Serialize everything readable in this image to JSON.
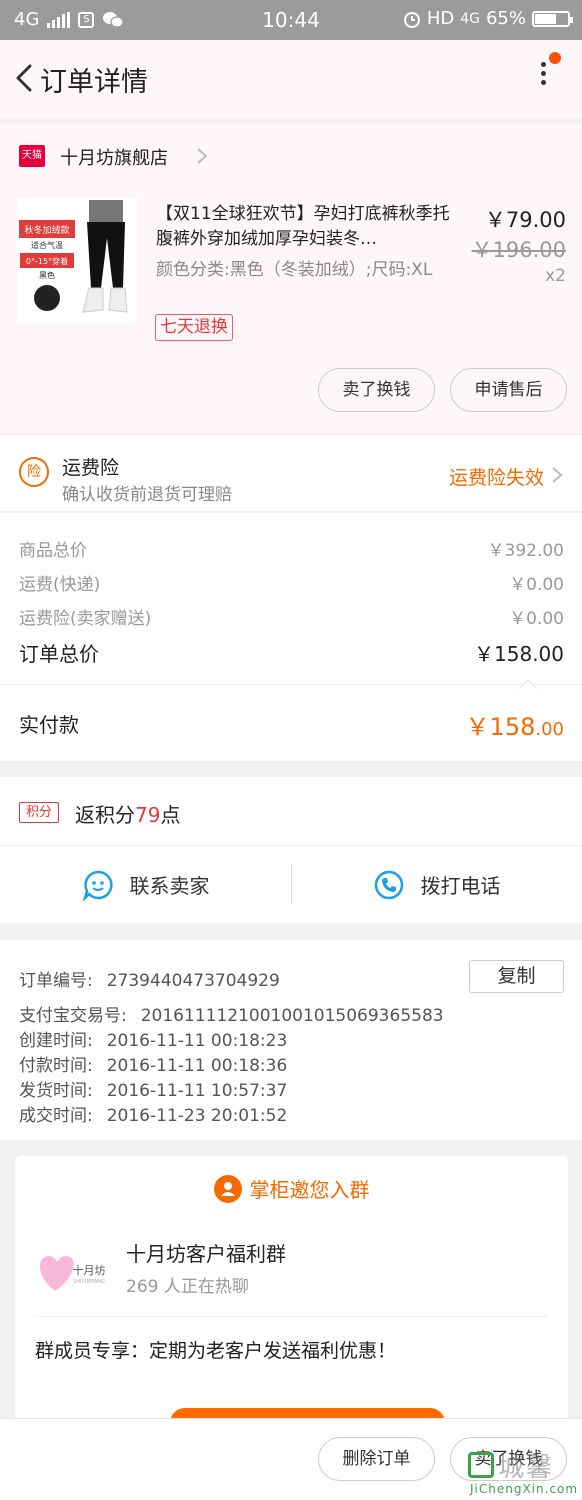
{
  "statusbar": {
    "network": "4G",
    "time": "10:44",
    "hd": "HD",
    "net2": "4G",
    "battery": "65%",
    "battery_level": 0.65
  },
  "header": {
    "title": "订单详情"
  },
  "shop": {
    "badge": "天猫",
    "name": "十月坊旗舰店"
  },
  "product": {
    "image_lines": [
      "秋冬加绒款",
      "适合气温",
      "0°-15°穿着",
      "黑色"
    ],
    "title": "【双11全球狂欢节】孕妇打底裤秋季托腹裤外穿加绒加厚孕妇装冬…",
    "spec": "颜色分类:黑色（冬装加绒）;尺码:XL",
    "tag": "七天退换",
    "price": "￥79.00",
    "orig_price": "￥196.00",
    "qty": "x2",
    "btn_sell": "卖了换钱",
    "btn_after": "申请售后"
  },
  "insurance": {
    "icon": "险",
    "title": "运费险",
    "subtitle": "确认收货前退货可理赔",
    "status": "运费险失效"
  },
  "costs": {
    "rows": [
      {
        "label": "商品总价",
        "value": "￥392.00"
      },
      {
        "label": "运费(快递)",
        "value": "￥0.00"
      },
      {
        "label": "运费险(卖家赠送)",
        "value": "￥0.00"
      }
    ],
    "total_label": "订单总价",
    "total_value": "￥158.00",
    "paid_label": "实付款",
    "paid_int": "￥158",
    "paid_dec": ".00"
  },
  "points": {
    "badge": "积分",
    "prefix": "返积分",
    "num": "79",
    "suffix": "点"
  },
  "contact": {
    "seller": "联系卖家",
    "phone": "拨打电话"
  },
  "order_info": {
    "copy": "复制",
    "rows": [
      {
        "label": "订单编号:",
        "value": "2739440473704929"
      },
      {
        "label": "支付宝交易号:",
        "value": "2016111121001001015069365583"
      },
      {
        "label": "创建时间:",
        "value": "2016-11-11 00:18:23"
      },
      {
        "label": "付款时间:",
        "value": "2016-11-11 00:18:36"
      },
      {
        "label": "发货时间:",
        "value": "2016-11-11 10:57:37"
      },
      {
        "label": "成交时间:",
        "value": "2016-11-23 20:01:52"
      }
    ]
  },
  "group": {
    "heading": "掌柜邀您入群",
    "logo_text": "十月坊",
    "logo_sub": "SHIYUEFANG",
    "name": "十月坊客户福利群",
    "online": "269 人正在热聊",
    "desc": "群成员专享：定期为老客户发送福利优惠！"
  },
  "bottom": {
    "delete": "删除订单",
    "sell": "卖了换钱"
  },
  "watermark": {
    "cn": "城馨",
    "en": "JiChengXin.com"
  }
}
